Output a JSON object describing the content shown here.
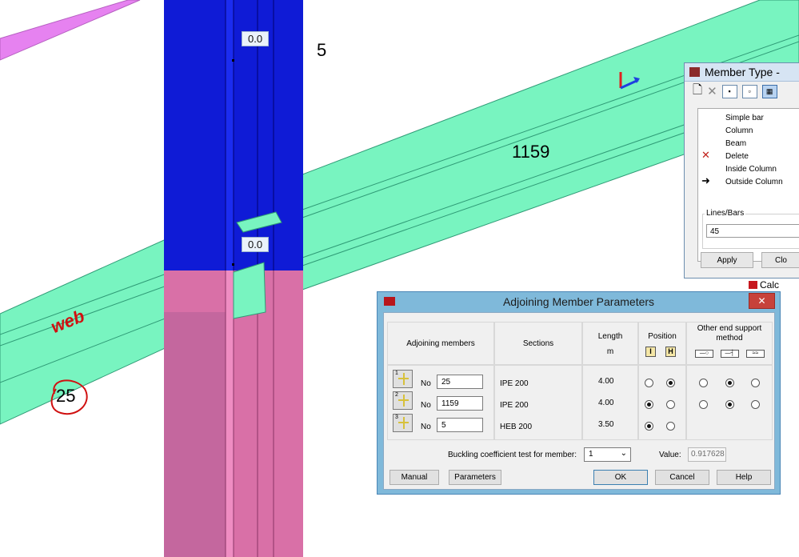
{
  "viewport": {
    "labels": {
      "dim_top": "0.0",
      "dim_mid": "0.0",
      "member_5": "5",
      "member_1159": "1159"
    },
    "annotations": {
      "web": "web",
      "number_25": "25"
    },
    "colors": {
      "beam": "#78f4c0",
      "column_blue": "#0f1bd6",
      "column_pink": "#d970a7",
      "magenta_beam": "#e682f0",
      "annotation": "#d01010"
    }
  },
  "member_type": {
    "title": "Member Type -",
    "items": [
      {
        "label": "Simple bar",
        "marker": ""
      },
      {
        "label": "Column",
        "marker": ""
      },
      {
        "label": "Beam",
        "marker": ""
      },
      {
        "label": "Delete",
        "marker": "x-icon"
      },
      {
        "label": "Inside Column",
        "marker": ""
      },
      {
        "label": "Outside Column",
        "marker": "arrow-icon"
      }
    ],
    "lines_label": "Lines/Bars",
    "lines_value": "45",
    "apply_label": "Apply",
    "close_label": "Clo"
  },
  "calc_partial": {
    "label": "Calc"
  },
  "dialog": {
    "title": "Adjoining Member Parameters",
    "close_label": "✕",
    "headers": {
      "members": "Adjoining members",
      "sections": "Sections",
      "length": "Length",
      "length_unit": "m",
      "position": "Position",
      "support": "Other end support method"
    },
    "no_label": "No",
    "rows": [
      {
        "index": "1",
        "member": "25",
        "section": "IPE 200",
        "length": "4.00",
        "position": 1,
        "support": 1
      },
      {
        "index": "2",
        "member": "1159",
        "section": "IPE 200",
        "length": "4.00",
        "position": 0,
        "support": 1
      },
      {
        "index": "3",
        "member": "5",
        "section": "HEB 200",
        "length": "3.50",
        "position": 0,
        "support": null
      }
    ],
    "buckling_label": "Buckling coefficient test for member:",
    "buckling_value": "1",
    "value_label": "Value:",
    "value_text": "0.917628",
    "buttons": {
      "manual": "Manual",
      "parameters": "Parameters",
      "ok": "OK",
      "cancel": "Cancel",
      "help": "Help"
    }
  }
}
